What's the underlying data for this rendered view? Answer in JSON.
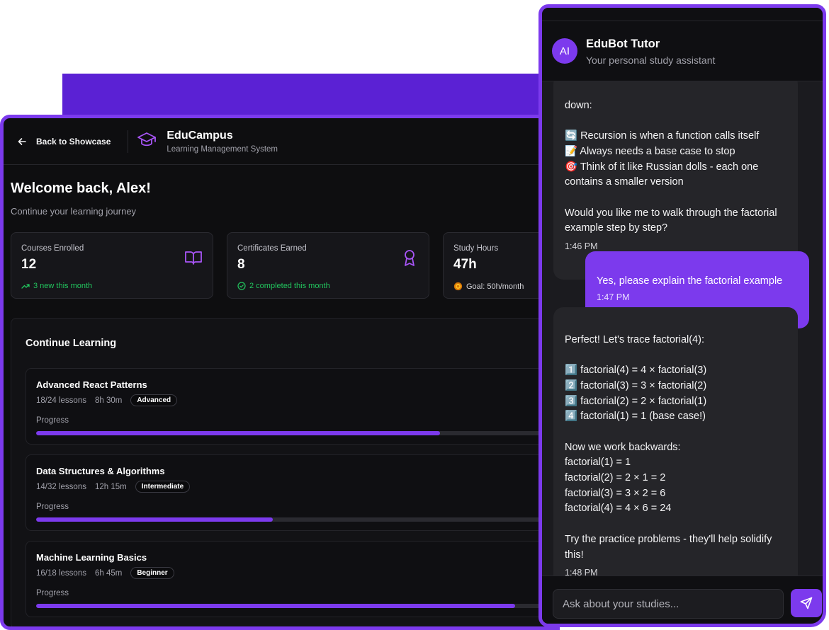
{
  "lms": {
    "back_label": "Back to Showcase",
    "brand_title": "EduCampus",
    "brand_subtitle": "Learning Management System",
    "welcome": "Welcome back, Alex!",
    "welcome_sub": "Continue your learning journey",
    "stats": [
      {
        "label": "Courses Enrolled",
        "value": "12",
        "note": "3 new this month",
        "icon": "book-icon"
      },
      {
        "label": "Certificates Earned",
        "value": "8",
        "note": "2 completed this month",
        "icon": "award-icon"
      },
      {
        "label": "Study Hours",
        "value": "47h",
        "note": "Goal: 50h/month",
        "icon": "target-icon"
      }
    ],
    "continue_title": "Continue Learning",
    "progress_label": "Progress",
    "courses": [
      {
        "title": "Advanced React Patterns",
        "lessons": "18/24 lessons",
        "duration": "8h 30m",
        "level": "Advanced",
        "progress": 0.75
      },
      {
        "title": "Data Structures & Algorithms",
        "lessons": "14/32 lessons",
        "duration": "12h 15m",
        "level": "Intermediate",
        "progress": 0.44
      },
      {
        "title": "Machine Learning Basics",
        "lessons": "16/18 lessons",
        "duration": "6h 45m",
        "level": "Beginner",
        "progress": 0.89
      }
    ]
  },
  "chat": {
    "avatar": "AI",
    "title": "EduBot Tutor",
    "subtitle": "Your personal study assistant",
    "messages": [
      {
        "role": "bot",
        "text": "down:\n\n🔄 Recursion is when a function calls itself\n📝 Always needs a base case to stop\n🎯 Think of it like Russian dolls - each one contains a smaller version\n\nWould you like me to walk through the factorial example step by step?",
        "time": "1:46 PM"
      },
      {
        "role": "user",
        "text": "Yes, please explain the factorial example",
        "time": "1:47 PM"
      },
      {
        "role": "bot",
        "text": "Perfect! Let's trace factorial(4):\n\n1️⃣ factorial(4) = 4 × factorial(3)\n2️⃣ factorial(3) = 3 × factorial(2)\n3️⃣ factorial(2) = 2 × factorial(1)\n4️⃣ factorial(1) = 1 (base case!)\n\nNow we work backwards:\nfactorial(1) = 1\nfactorial(2) = 2 × 1 = 2\nfactorial(3) = 3 × 2 = 6\nfactorial(4) = 4 × 6 = 24\n\nTry the practice problems - they'll help solidify this!",
        "time": "1:48 PM"
      }
    ],
    "input_placeholder": "Ask about your studies..."
  },
  "colors": {
    "accent": "#7c3aed",
    "success": "#22c55e",
    "background": "#0e0e10"
  }
}
